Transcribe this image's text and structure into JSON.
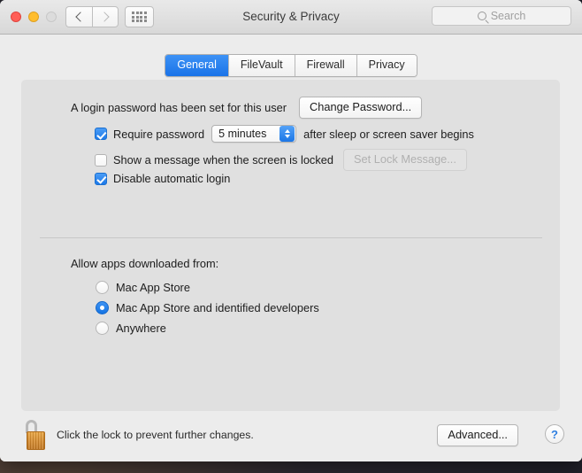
{
  "window": {
    "title": "Security & Privacy"
  },
  "titlebar": {
    "back_icon": "chevron-left-icon",
    "forward_icon": "chevron-right-icon",
    "showall_icon": "grid-dots-icon",
    "search": {
      "placeholder": "Search",
      "icon": "search-icon"
    }
  },
  "tabs": [
    {
      "label": "General",
      "active": true
    },
    {
      "label": "FileVault",
      "active": false
    },
    {
      "label": "Firewall",
      "active": false
    },
    {
      "label": "Privacy",
      "active": false
    }
  ],
  "general": {
    "password_status": "A login password has been set for this user",
    "change_password_button": "Change Password...",
    "require_password": {
      "label": "Require password",
      "checked": true,
      "interval_value": "5 minutes",
      "suffix": "after sleep or screen saver begins"
    },
    "lock_message": {
      "label": "Show a message when the screen is locked",
      "checked": false,
      "button": "Set Lock Message...",
      "button_disabled": true
    },
    "disable_auto_login": {
      "label": "Disable automatic login",
      "checked": true
    },
    "allow_apps": {
      "heading": "Allow apps downloaded from:",
      "options": [
        {
          "label": "Mac App Store",
          "selected": false
        },
        {
          "label": "Mac App Store and identified developers",
          "selected": true
        },
        {
          "label": "Anywhere",
          "selected": false
        }
      ]
    }
  },
  "bottom": {
    "lock_icon": "unlocked-padlock-icon",
    "lock_text": "Click the lock to prevent further changes.",
    "advanced_button": "Advanced...",
    "help_button": "?"
  },
  "colors": {
    "accent": "#1e7ae8",
    "tab_active_bg": "#1a73e8",
    "window_bg": "#ececec",
    "panel_bg": "#e0e0e0",
    "lock_gold": "#d4882a"
  }
}
